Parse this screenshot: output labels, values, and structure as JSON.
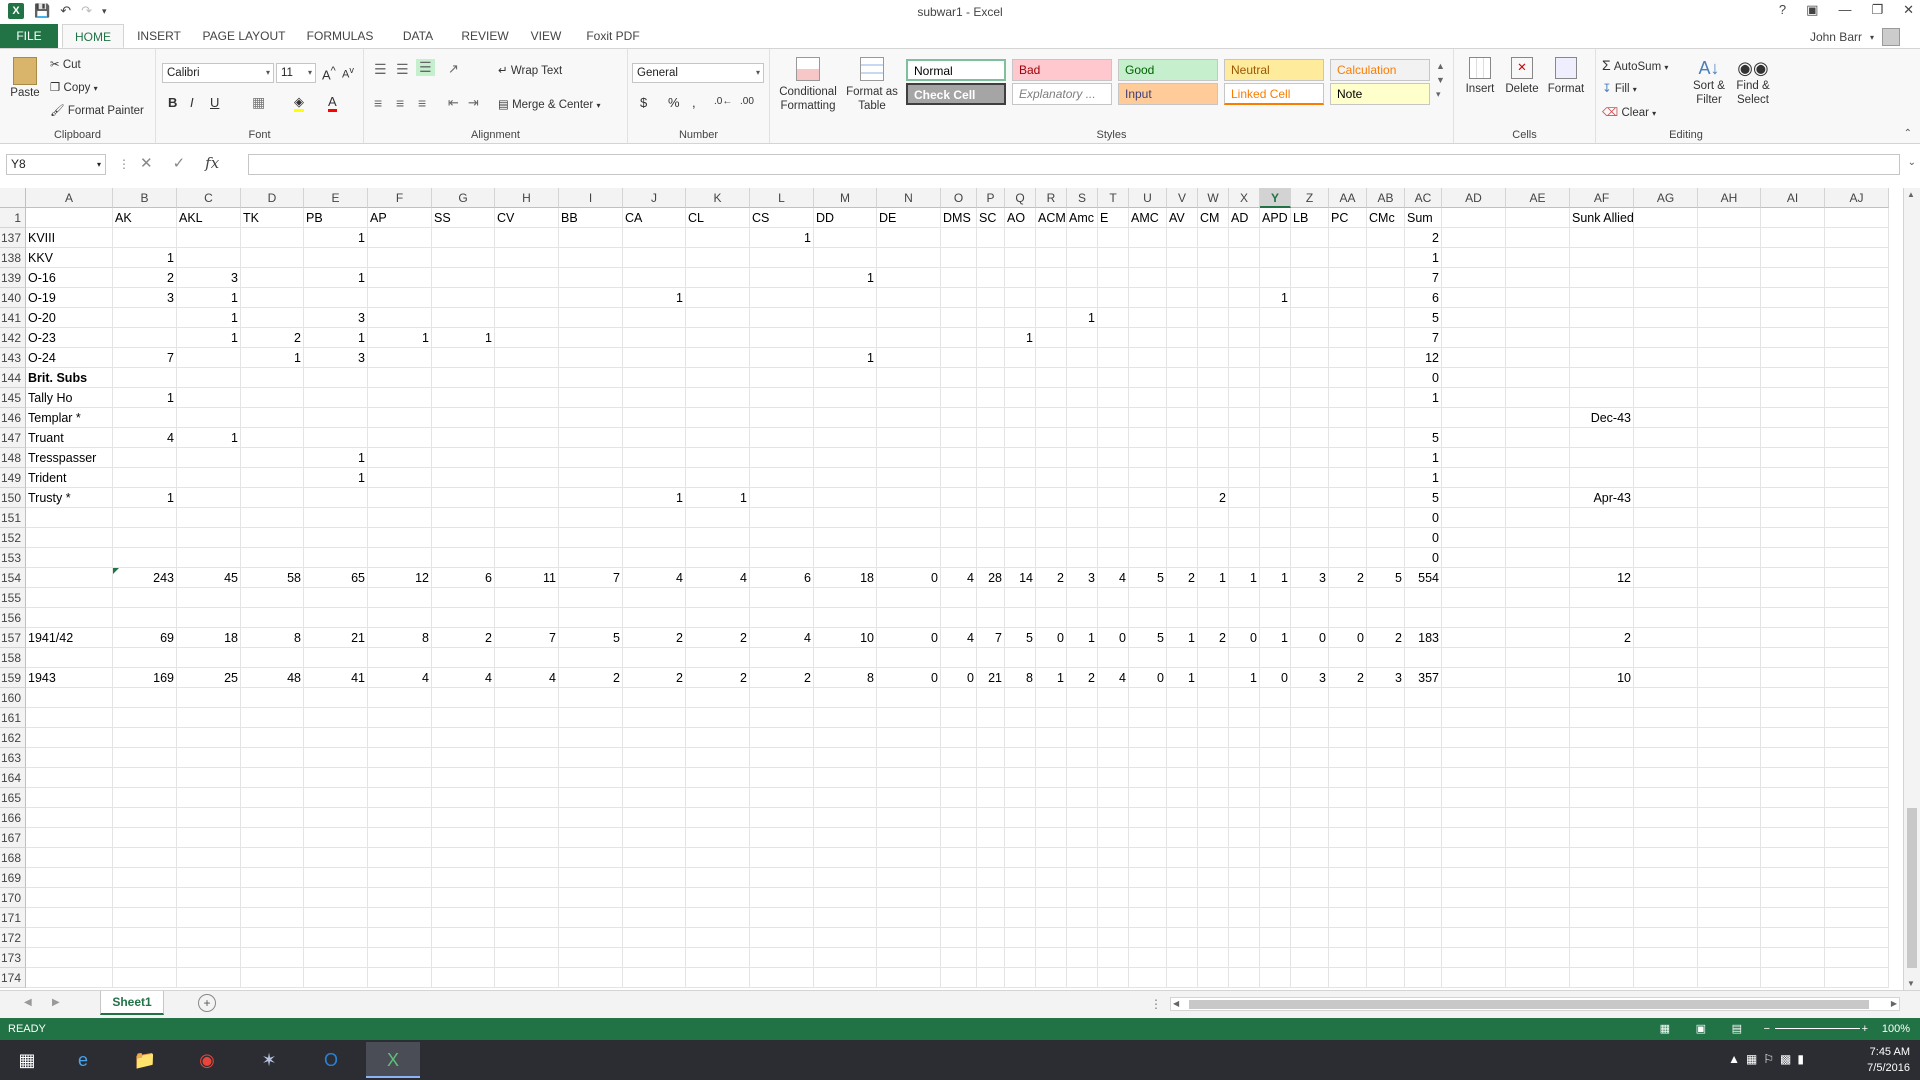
{
  "window": {
    "title": "subwar1 - Excel"
  },
  "ribbon_tabs": [
    "FILE",
    "HOME",
    "INSERT",
    "PAGE LAYOUT",
    "FORMULAS",
    "DATA",
    "REVIEW",
    "VIEW",
    "Foxit PDF"
  ],
  "user": {
    "name": "John Barr"
  },
  "clipboard": {
    "paste": "Paste",
    "cut": "Cut",
    "copy": "Copy",
    "format_painter": "Format Painter",
    "label": "Clipboard"
  },
  "font": {
    "name": "Calibri",
    "size": "11",
    "label": "Font"
  },
  "alignment": {
    "wrap_text": "Wrap Text",
    "merge_center": "Merge & Center",
    "label": "Alignment"
  },
  "number": {
    "format": "General",
    "label": "Number"
  },
  "styles": {
    "label": "Styles",
    "conditional": "Conditional Formatting",
    "format_table": "Format as Table",
    "cells": [
      {
        "name": "Normal",
        "bg": "#ffffff",
        "fg": "#000000"
      },
      {
        "name": "Bad",
        "bg": "#ffc7ce",
        "fg": "#9c0006"
      },
      {
        "name": "Good",
        "bg": "#c6efce",
        "fg": "#006100"
      },
      {
        "name": "Neutral",
        "bg": "#ffeb9c",
        "fg": "#9c5700"
      },
      {
        "name": "Calculation",
        "bg": "#f2f2f2",
        "fg": "#fa7d00"
      },
      {
        "name": "Check Cell",
        "bg": "#a5a5a5",
        "fg": "#ffffff"
      },
      {
        "name": "Explanatory ...",
        "bg": "#ffffff",
        "fg": "#7f7f7f"
      },
      {
        "name": "Input",
        "bg": "#ffcc99",
        "fg": "#3f3f76"
      },
      {
        "name": "Linked Cell",
        "bg": "#ffffff",
        "fg": "#fa7d00"
      },
      {
        "name": "Note",
        "bg": "#ffffcc",
        "fg": "#000000"
      }
    ]
  },
  "cells_group": {
    "insert": "Insert",
    "delete": "Delete",
    "format": "Format",
    "label": "Cells"
  },
  "editing": {
    "autosum": "AutoSum",
    "fill": "Fill",
    "clear": "Clear",
    "sort_filter": "Sort & Filter",
    "find_select": "Find & Select",
    "label": "Editing"
  },
  "formula_bar": {
    "name_box": "Y8",
    "formula": ""
  },
  "columns": [
    "A",
    "B",
    "C",
    "D",
    "E",
    "F",
    "G",
    "H",
    "I",
    "J",
    "K",
    "L",
    "M",
    "N",
    "O",
    "P",
    "Q",
    "R",
    "S",
    "T",
    "U",
    "V",
    "W",
    "X",
    "Y",
    "Z",
    "AA",
    "AB",
    "AC",
    "AD",
    "AE",
    "AF",
    "AG",
    "AH",
    "AI",
    "AJ"
  ],
  "selected_column": "Y",
  "rows": [
    {
      "n": "1",
      "c": {
        "B": "AK",
        "C": "AKL",
        "D": "TK",
        "E": "PB",
        "F": "AP",
        "G": "SS",
        "H": "CV",
        "I": "BB",
        "J": "CA",
        "K": "CL",
        "L": "CS",
        "M": "DD",
        "N": "DE",
        "O": "DMS",
        "P": "SC",
        "Q": "AO",
        "R": "ACM",
        "S": "Amc",
        "T": "E",
        "U": "AMC",
        "V": "AV",
        "W": "CM",
        "X": "AD",
        "Y": "APD",
        "Z": "LB",
        "AA": "PC",
        "AB": "CMc",
        "AC": "Sum",
        "AF": "Sunk Allied"
      }
    },
    {
      "n": "137",
      "c": {
        "A": "KVIII",
        "E": "1",
        "L": "1",
        "AC": "2"
      }
    },
    {
      "n": "138",
      "c": {
        "A": "KKV",
        "B": "1",
        "AC": "1"
      }
    },
    {
      "n": "139",
      "c": {
        "A": "O-16",
        "B": "2",
        "C": "3",
        "E": "1",
        "M": "1",
        "AC": "7"
      }
    },
    {
      "n": "140",
      "c": {
        "A": "O-19",
        "B": "3",
        "C": "1",
        "J": "1",
        "Y": "1",
        "AC": "6"
      }
    },
    {
      "n": "141",
      "c": {
        "A": "O-20",
        "C": "1",
        "E": "3",
        "S": "1",
        "AC": "5"
      }
    },
    {
      "n": "142",
      "c": {
        "A": "O-23",
        "C": "1",
        "D": "2",
        "E": "1",
        "F": "1",
        "G": "1",
        "Q": "1",
        "AC": "7"
      }
    },
    {
      "n": "143",
      "c": {
        "A": "O-24",
        "B": "7",
        "D": "1",
        "E": "3",
        "M": "1",
        "AC": "12"
      }
    },
    {
      "n": "144",
      "c": {
        "A": "Brit. Subs",
        "AC": "0"
      }
    },
    {
      "n": "145",
      "c": {
        "A": "Tally Ho",
        "B": "1",
        "AC": "1"
      }
    },
    {
      "n": "146",
      "c": {
        "A": "Templar *",
        "AF": "Dec-43"
      }
    },
    {
      "n": "147",
      "c": {
        "A": "Truant",
        "B": "4",
        "C": "1",
        "AC": "5"
      }
    },
    {
      "n": "148",
      "c": {
        "A": "Tresspasser",
        "E": "1",
        "AC": "1"
      }
    },
    {
      "n": "149",
      "c": {
        "A": "Trident",
        "E": "1",
        "AC": "1"
      }
    },
    {
      "n": "150",
      "c": {
        "A": "Trusty *",
        "B": "1",
        "J": "1",
        "K": "1",
        "W": "2",
        "AC": "5",
        "AF": "Apr-43"
      }
    },
    {
      "n": "151",
      "c": {
        "AC": "0"
      }
    },
    {
      "n": "152",
      "c": {
        "AC": "0"
      }
    },
    {
      "n": "153",
      "c": {
        "AC": "0"
      }
    },
    {
      "n": "154",
      "c": {
        "B": "243",
        "C": "45",
        "D": "58",
        "E": "65",
        "F": "12",
        "G": "6",
        "H": "11",
        "I": "7",
        "J": "4",
        "K": "4",
        "L": "6",
        "M": "18",
        "N": "0",
        "O": "4",
        "P": "28",
        "Q": "14",
        "R": "2",
        "S": "3",
        "T": "4",
        "U": "5",
        "V": "2",
        "W": "1",
        "X": "1",
        "Y": "1",
        "Z": "3",
        "AA": "2",
        "AB": "5",
        "AC": "554",
        "AF": "12"
      }
    },
    {
      "n": "155",
      "c": {}
    },
    {
      "n": "156",
      "c": {}
    },
    {
      "n": "157",
      "c": {
        "A": "1941/42",
        "B": "69",
        "C": "18",
        "D": "8",
        "E": "21",
        "F": "8",
        "G": "2",
        "H": "7",
        "I": "5",
        "J": "2",
        "K": "2",
        "L": "4",
        "M": "10",
        "N": "0",
        "O": "4",
        "P": "7",
        "Q": "5",
        "R": "0",
        "S": "1",
        "T": "0",
        "U": "5",
        "V": "1",
        "W": "2",
        "X": "0",
        "Y": "1",
        "Z": "0",
        "AA": "0",
        "AB": "2",
        "AC": "183",
        "AF": "2"
      }
    },
    {
      "n": "158",
      "c": {}
    },
    {
      "n": "159",
      "c": {
        "A": "1943",
        "B": "169",
        "C": "25",
        "D": "48",
        "E": "41",
        "F": "4",
        "G": "4",
        "H": "4",
        "I": "2",
        "J": "2",
        "K": "2",
        "L": "2",
        "M": "8",
        "N": "0",
        "O": "0",
        "P": "21",
        "Q": "8",
        "R": "1",
        "S": "2",
        "T": "4",
        "U": "0",
        "V": "1",
        "X": "1",
        "Y": "0",
        "Z": "3",
        "AA": "2",
        "AB": "3",
        "AC": "357",
        "AF": "10"
      }
    },
    {
      "n": "160",
      "c": {}
    },
    {
      "n": "161",
      "c": {}
    },
    {
      "n": "162",
      "c": {}
    },
    {
      "n": "163",
      "c": {}
    },
    {
      "n": "164",
      "c": {}
    },
    {
      "n": "165",
      "c": {}
    },
    {
      "n": "166",
      "c": {}
    },
    {
      "n": "167",
      "c": {}
    },
    {
      "n": "168",
      "c": {}
    },
    {
      "n": "169",
      "c": {}
    },
    {
      "n": "170",
      "c": {}
    },
    {
      "n": "171",
      "c": {}
    },
    {
      "n": "172",
      "c": {}
    },
    {
      "n": "173",
      "c": {}
    },
    {
      "n": "174",
      "c": {}
    }
  ],
  "bold_cells": [
    "144:A"
  ],
  "sheet_tabs": [
    "Sheet1"
  ],
  "status": {
    "mode": "READY",
    "zoom": "100%"
  },
  "taskbar": {
    "time": "7:45 AM",
    "date": "7/5/2016"
  }
}
